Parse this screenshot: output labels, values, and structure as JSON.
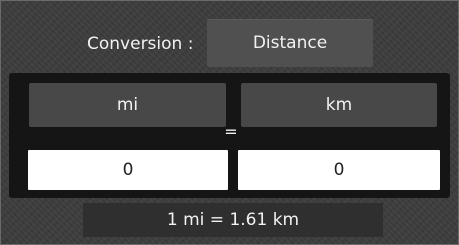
{
  "header": {
    "conversion_label": "Conversion :",
    "category_value": "Distance"
  },
  "converter": {
    "from_unit": "mi",
    "to_unit": "km",
    "equals_sign": "=",
    "from_value": "0",
    "to_value": "0"
  },
  "ratio": {
    "text": "1 mi = 1.61 km"
  }
}
